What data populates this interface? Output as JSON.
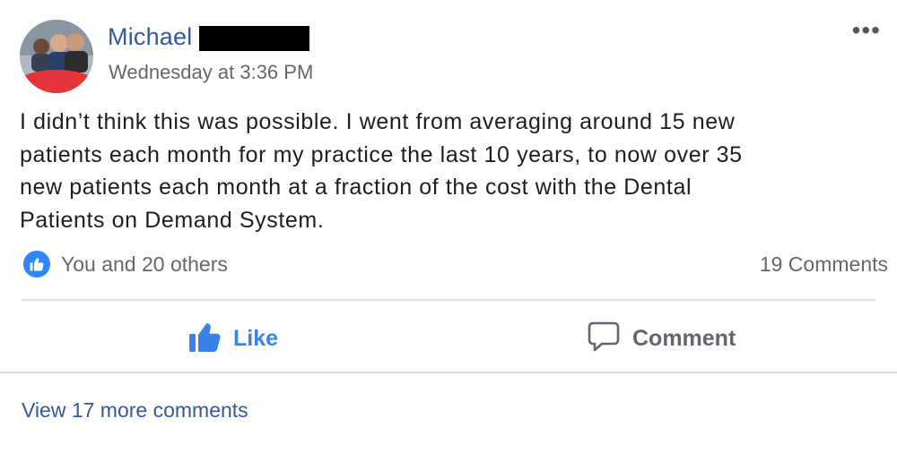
{
  "post": {
    "author_name": "Michael",
    "timestamp": "Wednesday at 3:36 PM",
    "more_menu": "•••",
    "body_lines": [
      "I didn’t think this was possible. I went from averaging around 15 new",
      "patients each month for my practice the last 10 years, to now over 35",
      "new patients each month at a fraction of the cost with the Dental",
      "Patients on Demand System."
    ]
  },
  "engagement": {
    "reactions_label": "You and 20 others",
    "comments_count": "19 Comments"
  },
  "actions": {
    "like_label": "Like",
    "comment_label": "Comment"
  },
  "footer": {
    "view_more_comments": "View 17 more comments"
  },
  "colors": {
    "author_link": "#365899",
    "like_blue": "#3b82e6",
    "muted_text": "#65676b",
    "divider": "#dadde1"
  },
  "icons": {
    "reaction_badge": "thumbs-up-icon",
    "like_action": "thumbs-up-icon",
    "comment_action": "speech-bubble-icon",
    "more": "ellipsis-icon"
  }
}
